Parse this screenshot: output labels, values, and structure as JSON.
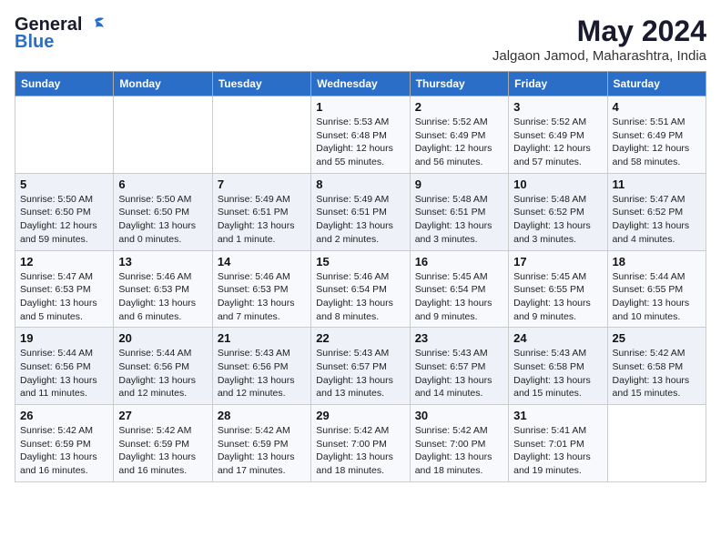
{
  "header": {
    "logo_general": "General",
    "logo_blue": "Blue",
    "month_title": "May 2024",
    "subtitle": "Jalgaon Jamod, Maharashtra, India"
  },
  "columns": [
    "Sunday",
    "Monday",
    "Tuesday",
    "Wednesday",
    "Thursday",
    "Friday",
    "Saturday"
  ],
  "weeks": [
    [
      {
        "day": "",
        "info": ""
      },
      {
        "day": "",
        "info": ""
      },
      {
        "day": "",
        "info": ""
      },
      {
        "day": "1",
        "info": "Sunrise: 5:53 AM\nSunset: 6:48 PM\nDaylight: 12 hours\nand 55 minutes."
      },
      {
        "day": "2",
        "info": "Sunrise: 5:52 AM\nSunset: 6:49 PM\nDaylight: 12 hours\nand 56 minutes."
      },
      {
        "day": "3",
        "info": "Sunrise: 5:52 AM\nSunset: 6:49 PM\nDaylight: 12 hours\nand 57 minutes."
      },
      {
        "day": "4",
        "info": "Sunrise: 5:51 AM\nSunset: 6:49 PM\nDaylight: 12 hours\nand 58 minutes."
      }
    ],
    [
      {
        "day": "5",
        "info": "Sunrise: 5:50 AM\nSunset: 6:50 PM\nDaylight: 12 hours\nand 59 minutes."
      },
      {
        "day": "6",
        "info": "Sunrise: 5:50 AM\nSunset: 6:50 PM\nDaylight: 13 hours\nand 0 minutes."
      },
      {
        "day": "7",
        "info": "Sunrise: 5:49 AM\nSunset: 6:51 PM\nDaylight: 13 hours\nand 1 minute."
      },
      {
        "day": "8",
        "info": "Sunrise: 5:49 AM\nSunset: 6:51 PM\nDaylight: 13 hours\nand 2 minutes."
      },
      {
        "day": "9",
        "info": "Sunrise: 5:48 AM\nSunset: 6:51 PM\nDaylight: 13 hours\nand 3 minutes."
      },
      {
        "day": "10",
        "info": "Sunrise: 5:48 AM\nSunset: 6:52 PM\nDaylight: 13 hours\nand 3 minutes."
      },
      {
        "day": "11",
        "info": "Sunrise: 5:47 AM\nSunset: 6:52 PM\nDaylight: 13 hours\nand 4 minutes."
      }
    ],
    [
      {
        "day": "12",
        "info": "Sunrise: 5:47 AM\nSunset: 6:53 PM\nDaylight: 13 hours\nand 5 minutes."
      },
      {
        "day": "13",
        "info": "Sunrise: 5:46 AM\nSunset: 6:53 PM\nDaylight: 13 hours\nand 6 minutes."
      },
      {
        "day": "14",
        "info": "Sunrise: 5:46 AM\nSunset: 6:53 PM\nDaylight: 13 hours\nand 7 minutes."
      },
      {
        "day": "15",
        "info": "Sunrise: 5:46 AM\nSunset: 6:54 PM\nDaylight: 13 hours\nand 8 minutes."
      },
      {
        "day": "16",
        "info": "Sunrise: 5:45 AM\nSunset: 6:54 PM\nDaylight: 13 hours\nand 9 minutes."
      },
      {
        "day": "17",
        "info": "Sunrise: 5:45 AM\nSunset: 6:55 PM\nDaylight: 13 hours\nand 9 minutes."
      },
      {
        "day": "18",
        "info": "Sunrise: 5:44 AM\nSunset: 6:55 PM\nDaylight: 13 hours\nand 10 minutes."
      }
    ],
    [
      {
        "day": "19",
        "info": "Sunrise: 5:44 AM\nSunset: 6:56 PM\nDaylight: 13 hours\nand 11 minutes."
      },
      {
        "day": "20",
        "info": "Sunrise: 5:44 AM\nSunset: 6:56 PM\nDaylight: 13 hours\nand 12 minutes."
      },
      {
        "day": "21",
        "info": "Sunrise: 5:43 AM\nSunset: 6:56 PM\nDaylight: 13 hours\nand 12 minutes."
      },
      {
        "day": "22",
        "info": "Sunrise: 5:43 AM\nSunset: 6:57 PM\nDaylight: 13 hours\nand 13 minutes."
      },
      {
        "day": "23",
        "info": "Sunrise: 5:43 AM\nSunset: 6:57 PM\nDaylight: 13 hours\nand 14 minutes."
      },
      {
        "day": "24",
        "info": "Sunrise: 5:43 AM\nSunset: 6:58 PM\nDaylight: 13 hours\nand 15 minutes."
      },
      {
        "day": "25",
        "info": "Sunrise: 5:42 AM\nSunset: 6:58 PM\nDaylight: 13 hours\nand 15 minutes."
      }
    ],
    [
      {
        "day": "26",
        "info": "Sunrise: 5:42 AM\nSunset: 6:59 PM\nDaylight: 13 hours\nand 16 minutes."
      },
      {
        "day": "27",
        "info": "Sunrise: 5:42 AM\nSunset: 6:59 PM\nDaylight: 13 hours\nand 16 minutes."
      },
      {
        "day": "28",
        "info": "Sunrise: 5:42 AM\nSunset: 6:59 PM\nDaylight: 13 hours\nand 17 minutes."
      },
      {
        "day": "29",
        "info": "Sunrise: 5:42 AM\nSunset: 7:00 PM\nDaylight: 13 hours\nand 18 minutes."
      },
      {
        "day": "30",
        "info": "Sunrise: 5:42 AM\nSunset: 7:00 PM\nDaylight: 13 hours\nand 18 minutes."
      },
      {
        "day": "31",
        "info": "Sunrise: 5:41 AM\nSunset: 7:01 PM\nDaylight: 13 hours\nand 19 minutes."
      },
      {
        "day": "",
        "info": ""
      }
    ]
  ]
}
